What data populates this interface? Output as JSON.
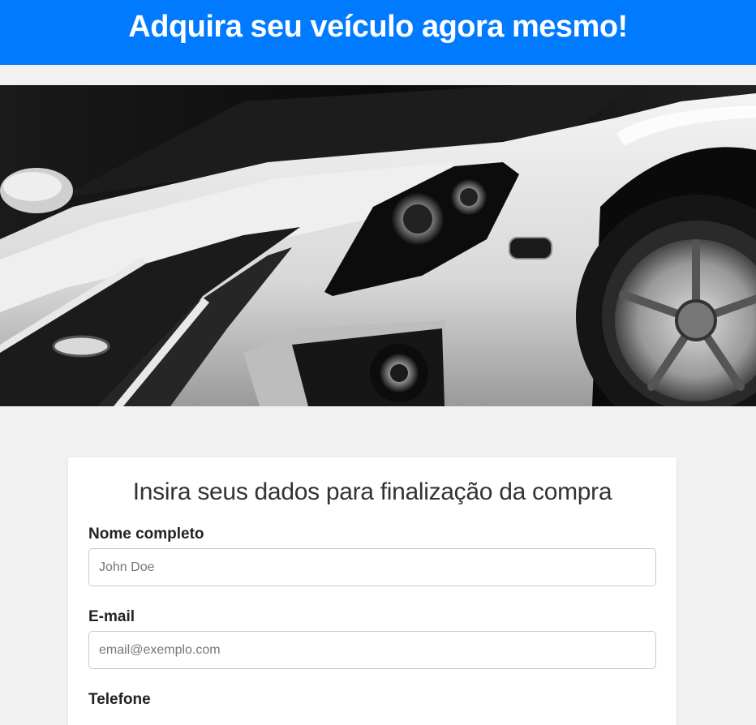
{
  "header": {
    "title": "Adquira seu veículo agora mesmo!",
    "background_color": "#007bff"
  },
  "hero": {
    "image": "white-sports-car-with-black-racing-stripes"
  },
  "form": {
    "title": "Insira seus dados para finalização da compra",
    "fields": [
      {
        "label": "Nome completo",
        "placeholder": "John Doe",
        "value": ""
      },
      {
        "label": "E-mail",
        "placeholder": "email@exemplo.com",
        "value": ""
      },
      {
        "label": "Telefone"
      }
    ]
  }
}
